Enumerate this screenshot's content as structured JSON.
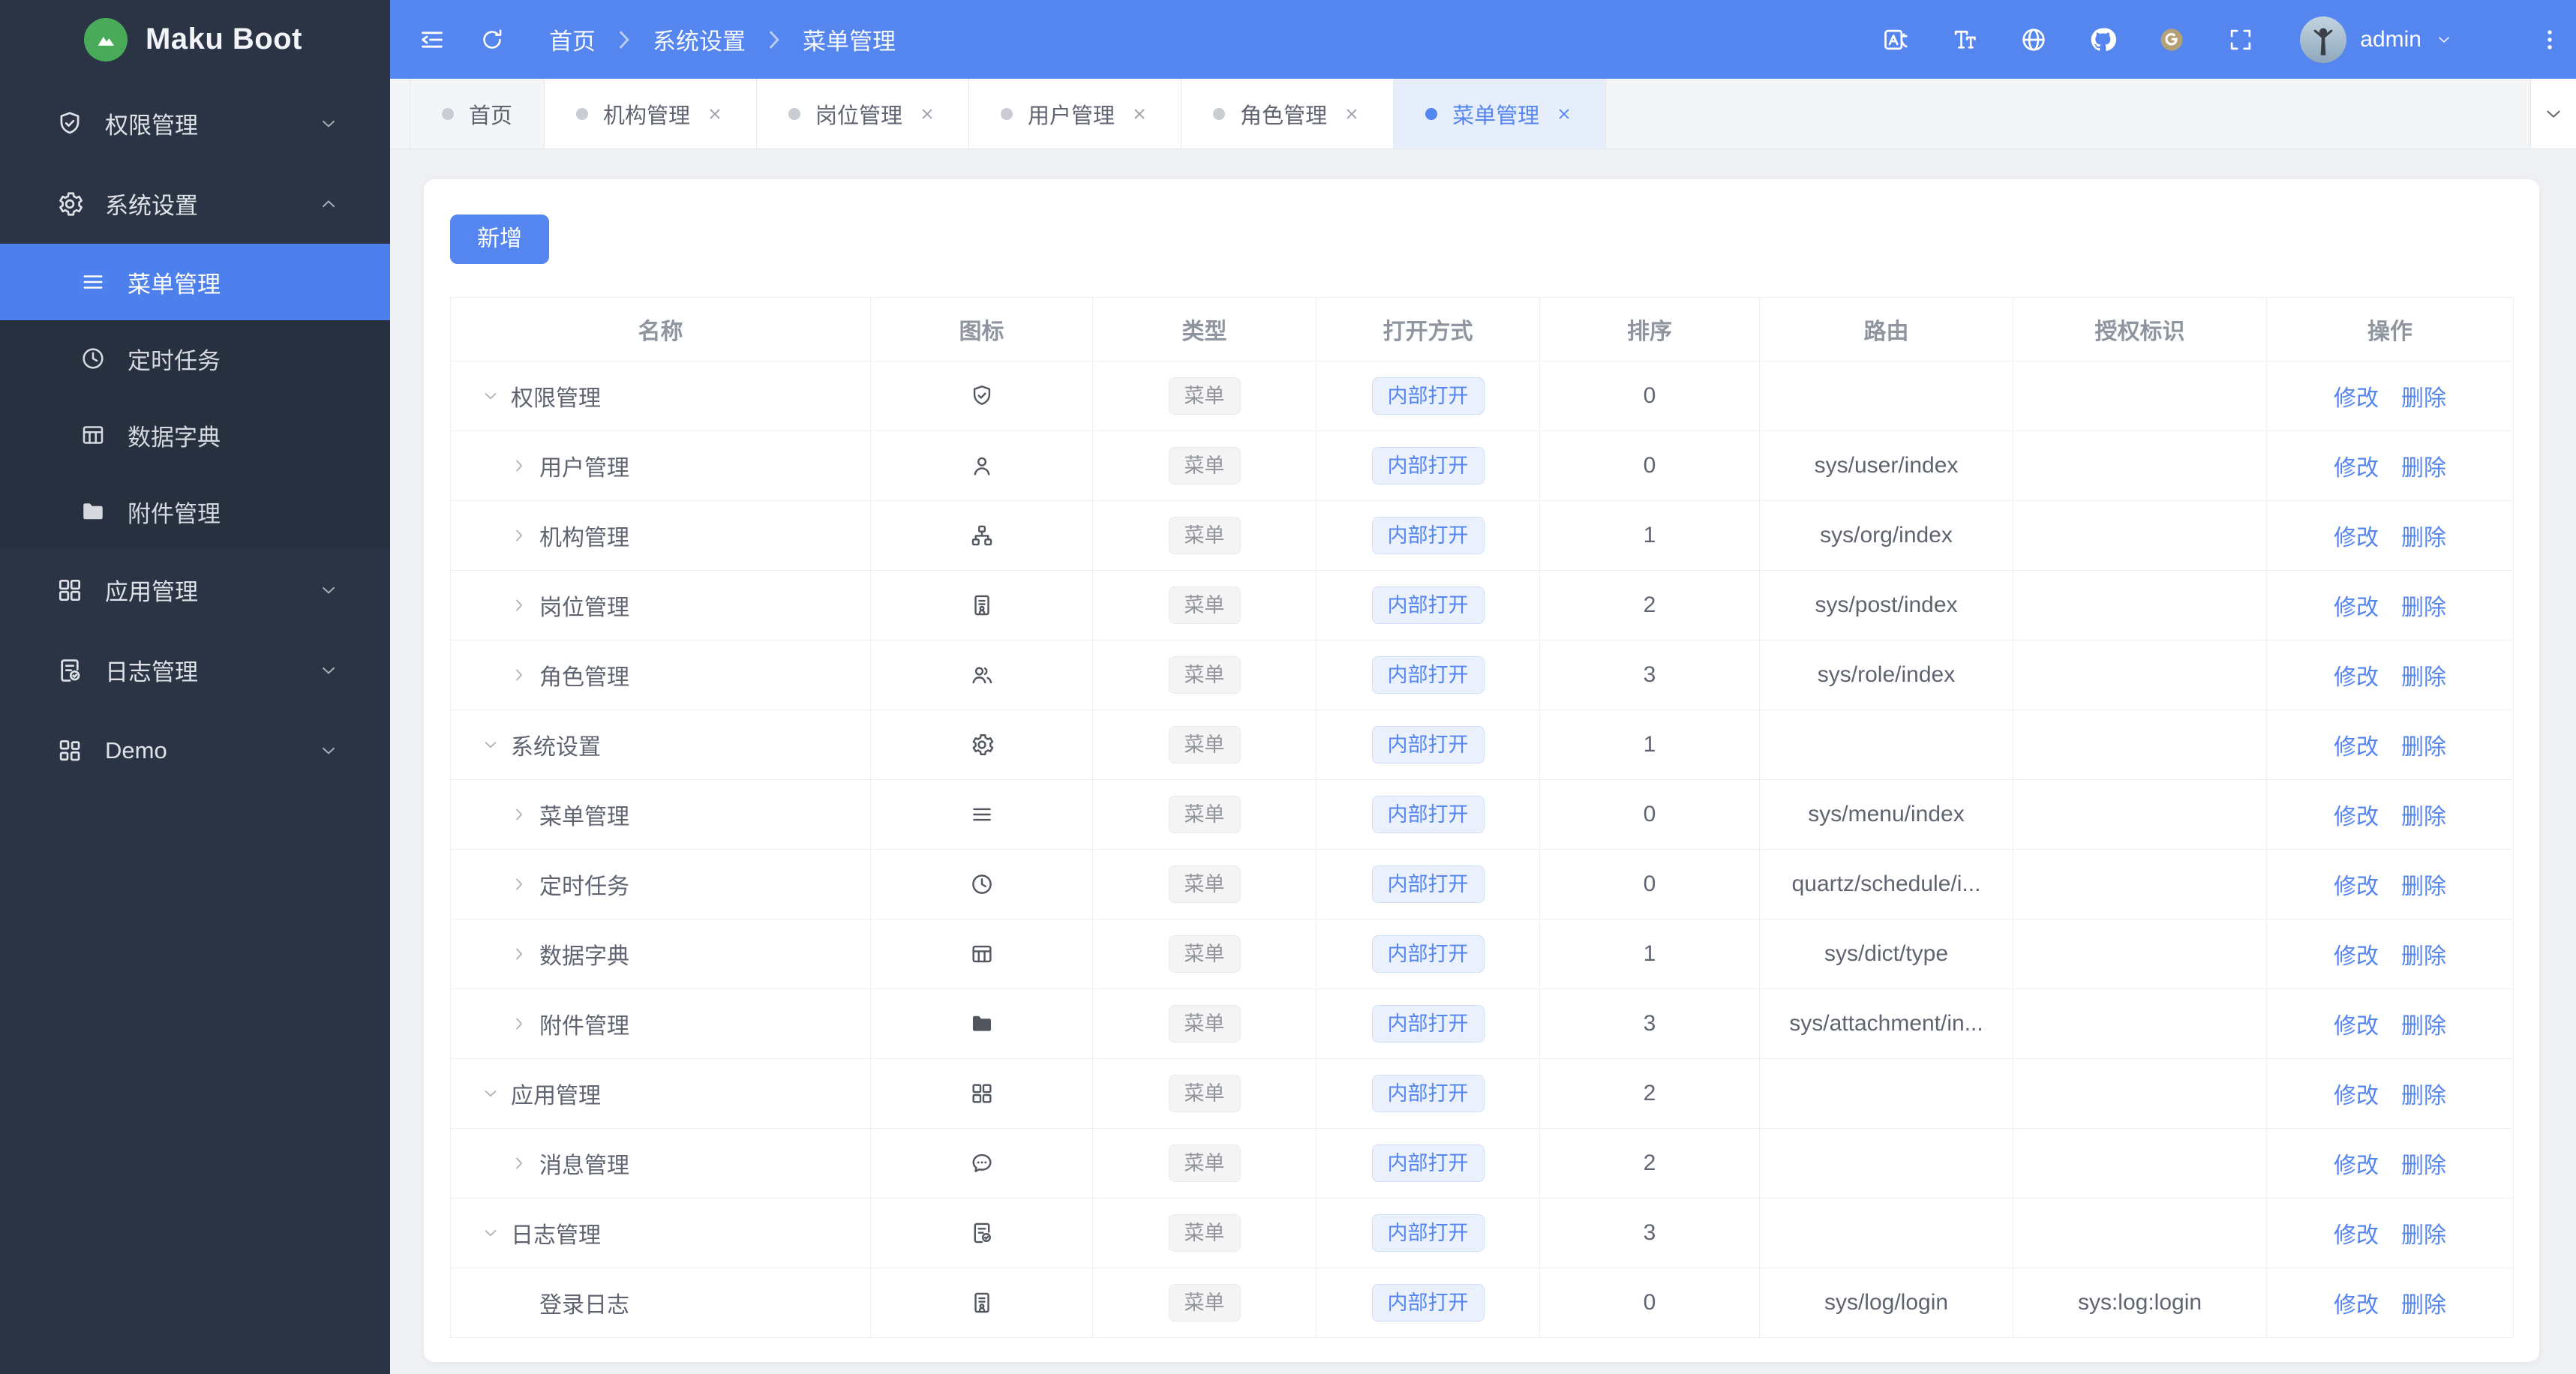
{
  "app": {
    "title": "Maku Boot"
  },
  "theme": {
    "accent_blue": "#5585ee",
    "sidebar_bg": "#2a3444",
    "sidebar_active_bg": "#4d80ec",
    "logo_green": "#49ab5a",
    "gitee_gold": "#b5a077",
    "page_bg": "#eef0f4",
    "tag_gray_text": "#909399",
    "table_border": "#ebeef5"
  },
  "sidebar": {
    "items": [
      {
        "id": "perm",
        "label": "权限管理",
        "icon": "i-shield-check",
        "state": "collapsed"
      },
      {
        "id": "system",
        "label": "系统设置",
        "icon": "i-gear",
        "state": "expanded",
        "children": [
          {
            "id": "menu",
            "label": "菜单管理",
            "icon": "i-menu-lines",
            "active": true
          },
          {
            "id": "schedule",
            "label": "定时任务",
            "icon": "i-clock",
            "active": false
          },
          {
            "id": "dict",
            "label": "数据字典",
            "icon": "i-dict-table",
            "active": false
          },
          {
            "id": "attachment",
            "label": "附件管理",
            "icon": "i-folder",
            "active": false
          }
        ]
      },
      {
        "id": "app",
        "label": "应用管理",
        "icon": "i-grid",
        "state": "collapsed"
      },
      {
        "id": "log",
        "label": "日志管理",
        "icon": "i-log-doc",
        "state": "collapsed"
      },
      {
        "id": "demo",
        "label": "Demo",
        "icon": "i-demo-grid",
        "state": "collapsed"
      }
    ]
  },
  "topbar": {
    "breadcrumb": [
      "首页",
      "系统设置",
      "菜单管理"
    ],
    "icons": [
      "translate",
      "font-size",
      "globe",
      "github",
      "gitee",
      "fullscreen"
    ],
    "user": "admin"
  },
  "tabs": [
    {
      "id": "home",
      "label": "首页",
      "closable": false,
      "active": false,
      "home": true
    },
    {
      "id": "org",
      "label": "机构管理",
      "closable": true,
      "active": false,
      "home": false
    },
    {
      "id": "post",
      "label": "岗位管理",
      "closable": true,
      "active": false,
      "home": false
    },
    {
      "id": "user",
      "label": "用户管理",
      "closable": true,
      "active": false,
      "home": false
    },
    {
      "id": "role",
      "label": "角色管理",
      "closable": true,
      "active": false,
      "home": false
    },
    {
      "id": "menu",
      "label": "菜单管理",
      "closable": true,
      "active": true,
      "home": false
    }
  ],
  "toolbar": {
    "add_label": "新增"
  },
  "table": {
    "columns": [
      "名称",
      "图标",
      "类型",
      "打开方式",
      "排序",
      "路由",
      "授权标识",
      "操作"
    ],
    "tags": {
      "type": "菜单",
      "open": "内部打开"
    },
    "actions": {
      "edit": "修改",
      "delete": "删除"
    },
    "rows": [
      {
        "name": "权限管理",
        "icon": "i-shield-check",
        "arrow": "down",
        "level": 0,
        "sort": "0",
        "route": "",
        "auth": ""
      },
      {
        "name": "用户管理",
        "icon": "i-user",
        "arrow": "right",
        "level": 1,
        "sort": "0",
        "route": "sys/user/index",
        "auth": ""
      },
      {
        "name": "机构管理",
        "icon": "i-org",
        "arrow": "right",
        "level": 1,
        "sort": "1",
        "route": "sys/org/index",
        "auth": ""
      },
      {
        "name": "岗位管理",
        "icon": "i-badge",
        "arrow": "right",
        "level": 1,
        "sort": "2",
        "route": "sys/post/index",
        "auth": ""
      },
      {
        "name": "角色管理",
        "icon": "i-users",
        "arrow": "right",
        "level": 1,
        "sort": "3",
        "route": "sys/role/index",
        "auth": ""
      },
      {
        "name": "系统设置",
        "icon": "i-gear",
        "arrow": "down",
        "level": 0,
        "sort": "1",
        "route": "",
        "auth": ""
      },
      {
        "name": "菜单管理",
        "icon": "i-menu-lines",
        "arrow": "right",
        "level": 1,
        "sort": "0",
        "route": "sys/menu/index",
        "auth": ""
      },
      {
        "name": "定时任务",
        "icon": "i-clock",
        "arrow": "right",
        "level": 1,
        "sort": "0",
        "route": "quartz/schedule/i...",
        "auth": ""
      },
      {
        "name": "数据字典",
        "icon": "i-dict-table",
        "arrow": "right",
        "level": 1,
        "sort": "1",
        "route": "sys/dict/type",
        "auth": ""
      },
      {
        "name": "附件管理",
        "icon": "i-folder",
        "arrow": "right",
        "level": 1,
        "sort": "3",
        "route": "sys/attachment/in...",
        "auth": ""
      },
      {
        "name": "应用管理",
        "icon": "i-grid",
        "arrow": "down",
        "level": 0,
        "sort": "2",
        "route": "",
        "auth": ""
      },
      {
        "name": "消息管理",
        "icon": "i-message",
        "arrow": "right",
        "level": 1,
        "sort": "2",
        "route": "",
        "auth": ""
      },
      {
        "name": "日志管理",
        "icon": "i-log-doc",
        "arrow": "down",
        "level": 0,
        "sort": "3",
        "route": "",
        "auth": ""
      },
      {
        "name": "登录日志",
        "icon": "i-login-log",
        "arrow": "none",
        "level": 1,
        "sort": "0",
        "route": "sys/log/login",
        "auth": "sys:log:login"
      }
    ]
  }
}
